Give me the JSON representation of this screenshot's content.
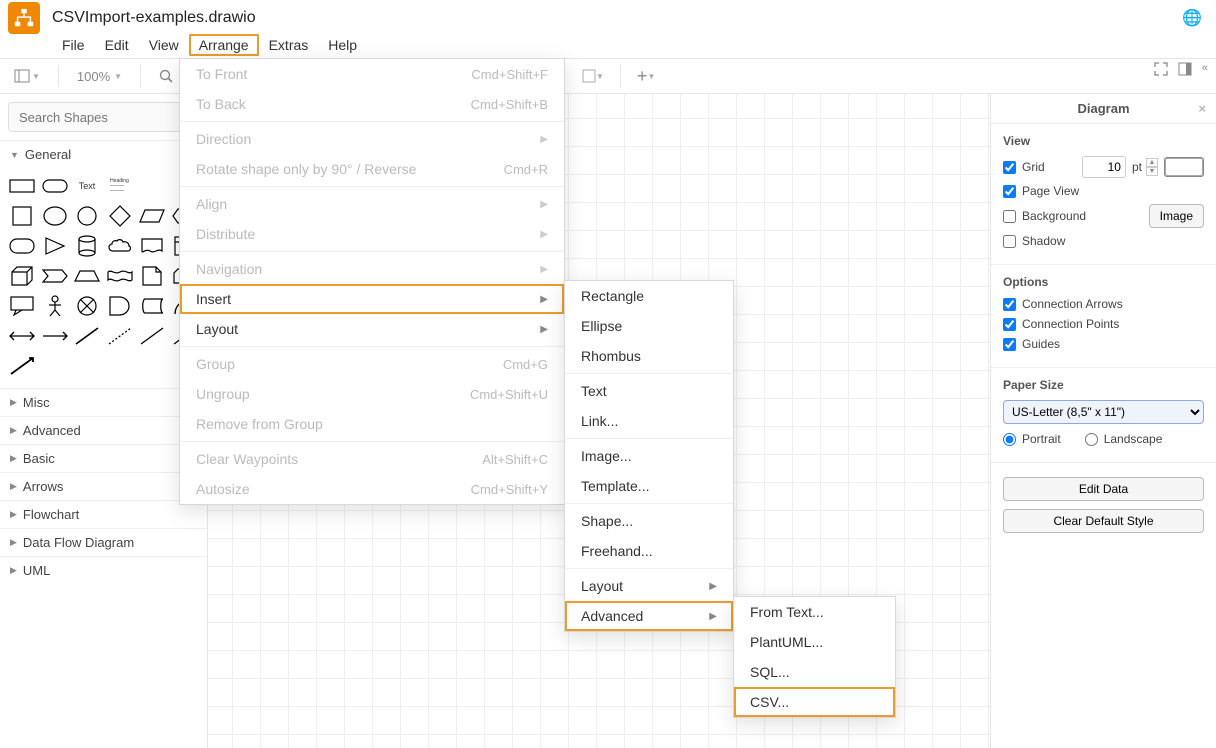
{
  "title": "CSVImport-examples.drawio",
  "menubar": [
    "File",
    "Edit",
    "View",
    "Arrange",
    "Extras",
    "Help"
  ],
  "menubar_highlight_index": 3,
  "toolbar": {
    "zoom": "100%"
  },
  "search": {
    "placeholder": "Search Shapes"
  },
  "sidebar_sections": [
    "General",
    "Misc",
    "Advanced",
    "Basic",
    "Arrows",
    "Flowchart",
    "Data Flow Diagram",
    "UML"
  ],
  "arrange_menu": [
    {
      "label": "To Front",
      "shortcut": "Cmd+Shift+F",
      "disabled": true
    },
    {
      "label": "To Back",
      "shortcut": "Cmd+Shift+B",
      "disabled": true
    },
    {
      "sep": true
    },
    {
      "label": "Direction",
      "submenu": true,
      "disabled": true
    },
    {
      "label": "Rotate shape only by 90° / Reverse",
      "shortcut": "Cmd+R",
      "disabled": true
    },
    {
      "sep": true
    },
    {
      "label": "Align",
      "submenu": true,
      "disabled": true
    },
    {
      "label": "Distribute",
      "submenu": true,
      "disabled": true
    },
    {
      "sep": true
    },
    {
      "label": "Navigation",
      "submenu": true,
      "disabled": true
    },
    {
      "label": "Insert",
      "submenu": true,
      "highlight": true
    },
    {
      "label": "Layout",
      "submenu": true
    },
    {
      "sep": true
    },
    {
      "label": "Group",
      "shortcut": "Cmd+G",
      "disabled": true
    },
    {
      "label": "Ungroup",
      "shortcut": "Cmd+Shift+U",
      "disabled": true
    },
    {
      "label": "Remove from Group",
      "disabled": true
    },
    {
      "sep": true
    },
    {
      "label": "Clear Waypoints",
      "shortcut": "Alt+Shift+C",
      "disabled": true
    },
    {
      "label": "Autosize",
      "shortcut": "Cmd+Shift+Y",
      "disabled": true
    }
  ],
  "insert_menu": [
    {
      "label": "Rectangle"
    },
    {
      "label": "Ellipse"
    },
    {
      "label": "Rhombus"
    },
    {
      "sep": true
    },
    {
      "label": "Text"
    },
    {
      "label": "Link..."
    },
    {
      "sep": true
    },
    {
      "label": "Image..."
    },
    {
      "label": "Template..."
    },
    {
      "sep": true
    },
    {
      "label": "Shape..."
    },
    {
      "label": "Freehand..."
    },
    {
      "sep": true
    },
    {
      "label": "Layout",
      "submenu": true
    },
    {
      "label": "Advanced",
      "submenu": true,
      "highlight": true
    }
  ],
  "advanced_menu": [
    {
      "label": "From Text..."
    },
    {
      "label": "PlantUML..."
    },
    {
      "label": "SQL..."
    },
    {
      "label": "CSV...",
      "highlight": true
    }
  ],
  "right_panel": {
    "title": "Diagram",
    "view": {
      "title": "View",
      "grid_label": "Grid",
      "grid_checked": true,
      "grid_value": "10",
      "grid_unit": "pt",
      "pageview_label": "Page View",
      "pageview_checked": true,
      "background_label": "Background",
      "background_checked": false,
      "background_btn": "Image",
      "shadow_label": "Shadow",
      "shadow_checked": false
    },
    "options": {
      "title": "Options",
      "conn_arrows": {
        "label": "Connection Arrows",
        "checked": true
      },
      "conn_points": {
        "label": "Connection Points",
        "checked": true
      },
      "guides": {
        "label": "Guides",
        "checked": true
      }
    },
    "paper": {
      "title": "Paper Size",
      "value": "US-Letter (8,5\" x 11\")",
      "portrait": "Portrait",
      "landscape": "Landscape",
      "orientation": "portrait"
    },
    "buttons": {
      "edit_data": "Edit Data",
      "clear_style": "Clear Default Style"
    }
  }
}
